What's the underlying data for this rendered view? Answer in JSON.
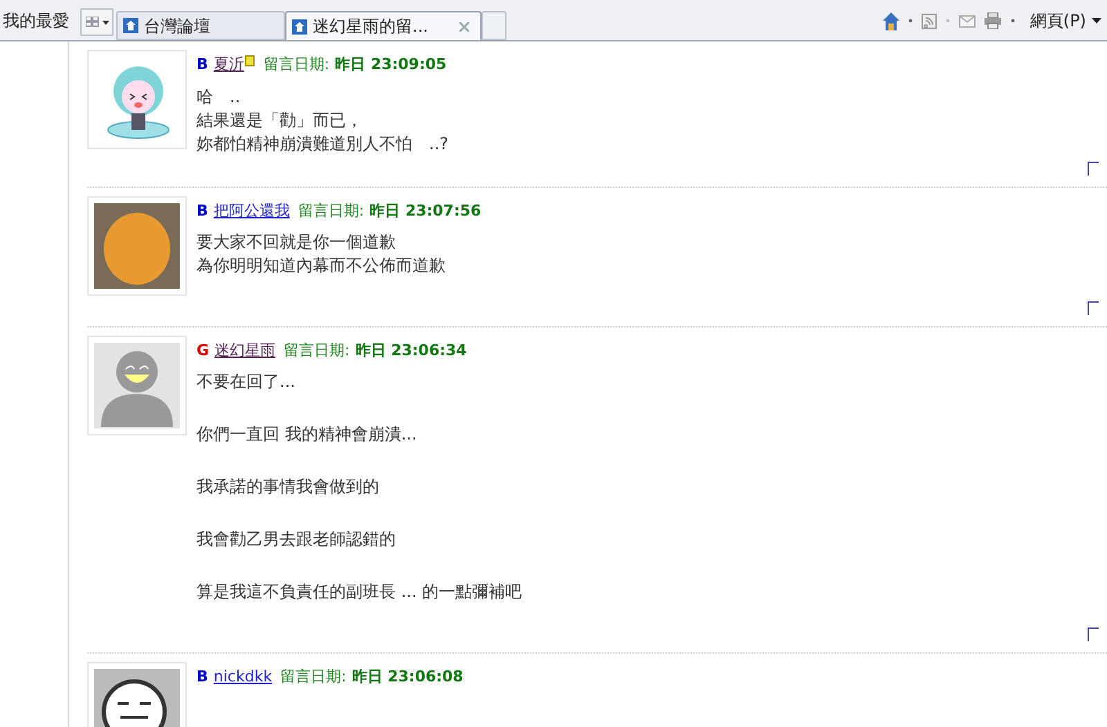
{
  "toolbar": {
    "favorites": "我的最愛",
    "tabs": [
      {
        "label": "台灣論壇",
        "selected": false,
        "closable": false
      },
      {
        "label": "迷幻星雨的留...",
        "selected": true,
        "closable": true
      }
    ],
    "page_menu": "網頁(P)"
  },
  "posts": [
    {
      "gender": {
        "letter": "B",
        "kind": "male"
      },
      "name": "夏沂",
      "visited": true,
      "badge": true,
      "date_label": "留言日期:",
      "date": "昨日 23:09:05",
      "avatar": {
        "kind": "cartoon"
      },
      "lines": [
        "哈　..",
        "結果還是「勸」而已，",
        "妳都怕精神崩潰難道別人不怕　..?"
      ]
    },
    {
      "gender": {
        "letter": "B",
        "kind": "male"
      },
      "name": "把阿公還我",
      "visited": false,
      "badge": false,
      "date_label": "留言日期:",
      "date": "昨日 23:07:56",
      "avatar": {
        "kind": "photo"
      },
      "lines": [
        "要大家不回就是你一個道歉",
        "為你明明知道內幕而不公佈而道歉"
      ]
    },
    {
      "gender": {
        "letter": "G",
        "kind": "female"
      },
      "name": "迷幻星雨",
      "visited": true,
      "badge": false,
      "date_label": "留言日期:",
      "date": "昨日 23:06:34",
      "avatar": {
        "kind": "silhouette"
      },
      "paragraphs": [
        "不要在回了...",
        "你們一直回 我的精神會崩潰...",
        "我承諾的事情我會做到的",
        "我會勸乙男去跟老師認錯的",
        "算是我這不負責任的副班長 ... 的一點彌補吧"
      ]
    },
    {
      "gender": {
        "letter": "B",
        "kind": "male"
      },
      "name": "nickdkk",
      "visited": false,
      "badge": false,
      "date_label": "留言日期:",
      "date": "昨日 23:06:08",
      "avatar": {
        "kind": "face"
      }
    }
  ]
}
